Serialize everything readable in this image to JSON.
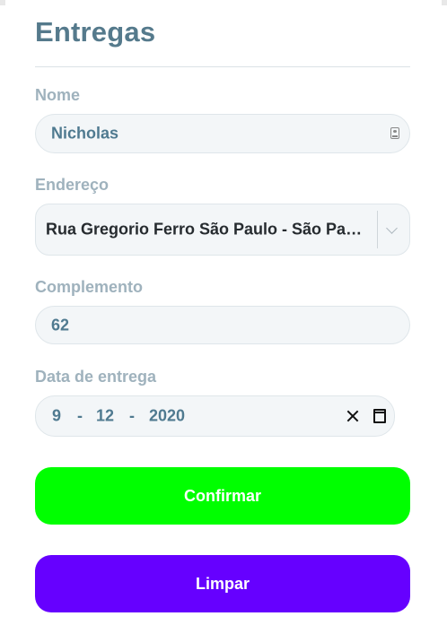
{
  "form": {
    "title": "Entregas",
    "name": {
      "label": "Nome",
      "value": "Nicholas"
    },
    "address": {
      "label": "Endereço",
      "selected": "Rua Gregorio Ferro São Paulo - São Paulo"
    },
    "complement": {
      "label": "Complemento",
      "value": "62"
    },
    "delivery_date": {
      "label": "Data de entrega",
      "day": "9",
      "month": "12",
      "year": "2020",
      "separator": "-"
    },
    "confirm_label": "Confirmar",
    "clear_label": "Limpar"
  },
  "colors": {
    "title": "#557a8c",
    "label": "#9fb2bd",
    "confirm_button": "#00ff00",
    "clear_button": "#6600ff"
  },
  "icons": {
    "name_field": "contact-card-icon",
    "address_select": "chevron-down-icon",
    "date_clear": "close-icon",
    "date_picker": "calendar-icon"
  }
}
